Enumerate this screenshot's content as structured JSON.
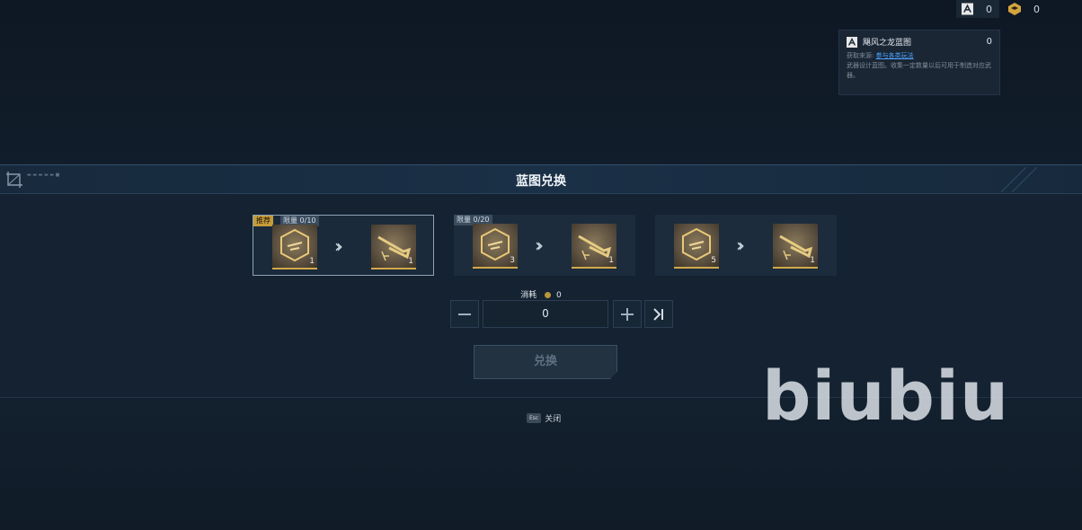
{
  "currency": [
    {
      "icon": "blueprint-token-icon",
      "value": "0"
    },
    {
      "icon": "gold-crate-icon",
      "value": "0"
    }
  ],
  "tooltip": {
    "title": "飓风之龙蓝图",
    "count": "0",
    "source_prefix": "获取来源:",
    "source_link": "参与各类玩法",
    "desc": "武器设计蓝图。收集一定数量以后可用于制造对应武器。"
  },
  "panel": {
    "title": "蓝图兑换"
  },
  "cards": [
    {
      "recommend": "推荐",
      "limit": "限量 0/10",
      "cost_qty": "1",
      "gain_qty": "1"
    },
    {
      "recommend": "",
      "limit": "限量 0/20",
      "cost_qty": "3",
      "gain_qty": "1"
    },
    {
      "recommend": "",
      "limit": "",
      "cost_qty": "5",
      "gain_qty": "1"
    }
  ],
  "cost": {
    "label": "消耗",
    "value": "0"
  },
  "quantity": {
    "value": "0"
  },
  "exchange_button": "兑换",
  "close": {
    "key": "Esc",
    "label": "关闭"
  },
  "watermark": "biubiu",
  "colors": {
    "accent_gold": "#d2a94a",
    "selected_border": "#8fa3b5",
    "link": "#4ea3ff"
  }
}
